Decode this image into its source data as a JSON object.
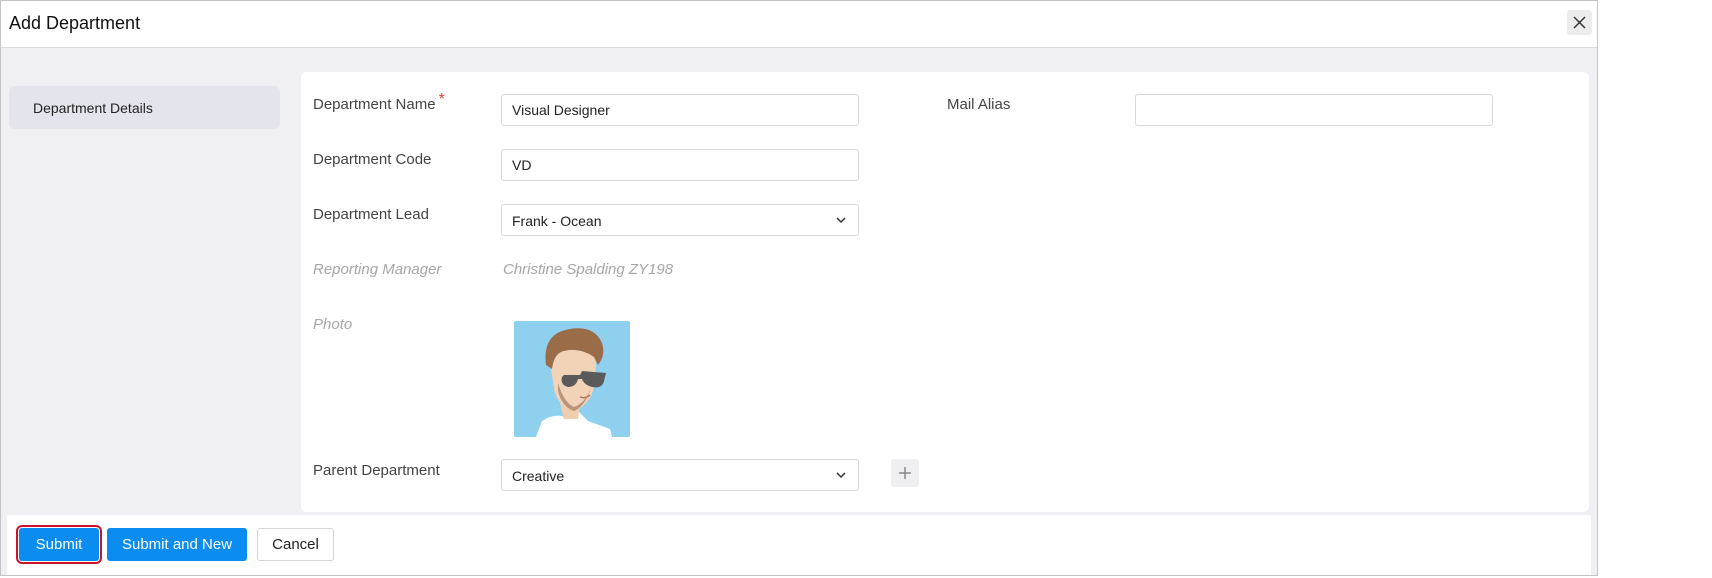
{
  "dialog": {
    "title": "Add Department",
    "close_icon": "close-icon"
  },
  "sidebar": {
    "items": [
      {
        "label": "Department Details",
        "selected": true
      }
    ]
  },
  "form": {
    "department_name": {
      "label": "Department Name",
      "required_mark": "*",
      "value": "Visual Designer"
    },
    "mail_alias": {
      "label": "Mail Alias",
      "value": ""
    },
    "department_code": {
      "label": "Department Code",
      "value": "VD"
    },
    "department_lead": {
      "label": "Department Lead",
      "value": "Frank - Ocean",
      "icon": "chevron-down-icon"
    },
    "reporting_manager": {
      "label": "Reporting Manager",
      "value": "Christine Spalding ZY198"
    },
    "photo": {
      "label": "Photo"
    },
    "parent_department": {
      "label": "Parent Department",
      "value": "Creative",
      "icon": "chevron-down-icon",
      "add_icon": "plus-icon"
    }
  },
  "footer": {
    "submit_label": "Submit",
    "submit_new_label": "Submit and New",
    "cancel_label": "Cancel"
  },
  "colors": {
    "primary": "#0a8cf0",
    "required": "#e0403a",
    "focus_outline": "#c8152c",
    "photo_background": "#8fd0ee"
  }
}
